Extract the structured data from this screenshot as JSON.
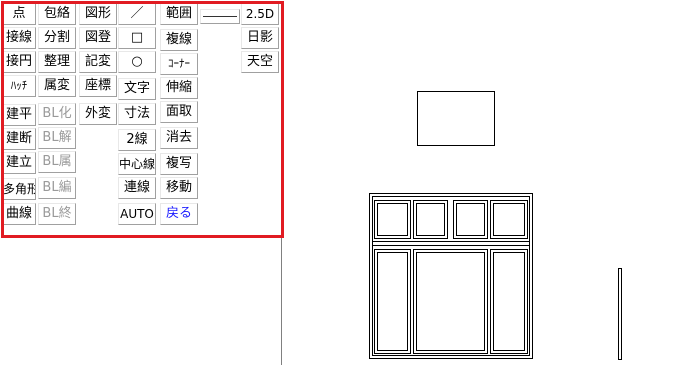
{
  "colors": {
    "highlight": "#e11b22",
    "disabled": "#9a9a9a",
    "accent_blue": "#1a1aff"
  },
  "toolbar": {
    "col1": [
      "点",
      "接線",
      "接円",
      "ﾊｯﾁ",
      "建平",
      "建断",
      "建立",
      "多角形",
      "曲線"
    ],
    "col2": [
      "包絡",
      "分割",
      "整理",
      "属変",
      "BL化",
      "BL解",
      "BL属",
      "BL編",
      "BL終"
    ],
    "col3": [
      "図形",
      "図登",
      "記変",
      "座標",
      "外変"
    ],
    "col4": [
      "／",
      "□",
      "○",
      "文字",
      "寸法",
      "2線",
      "中心線",
      "連線",
      "AUTO"
    ],
    "col5": [
      "範囲",
      "複線",
      "ｺｰﾅｰ",
      "伸縮",
      "面取",
      "消去",
      "複写",
      "移動",
      "戻る"
    ],
    "col7": [
      "2.5D",
      "日影",
      "天空"
    ],
    "disabled": [
      "BL化",
      "BL解",
      "BL属",
      "BL編",
      "BL終"
    ]
  }
}
